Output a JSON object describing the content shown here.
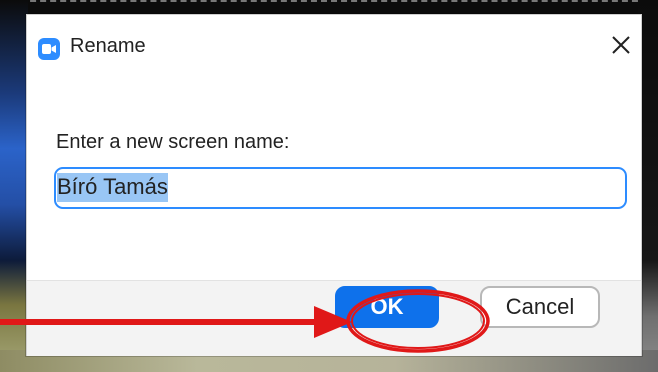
{
  "dialog": {
    "title": "Rename",
    "prompt": "Enter a new screen name:",
    "name_value": "Bíró Tamás",
    "ok_label": "OK",
    "cancel_label": "Cancel",
    "close_glyph": "✕"
  },
  "icons": {
    "app": "zoom-camera-icon",
    "close": "close-icon"
  },
  "colors": {
    "accent": "#0e71eb",
    "input_border": "#2d8cff",
    "selection": "#99c6f5",
    "annotation": "#e01818"
  }
}
